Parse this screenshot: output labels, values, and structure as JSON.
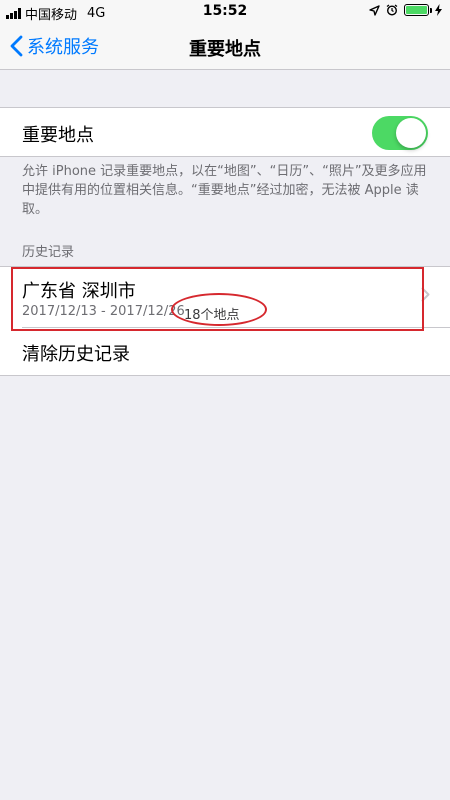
{
  "status_bar": {
    "carrier": "中国移动",
    "network": "4G",
    "time": "15:52",
    "battery_level": 1.0,
    "battery_color": "#4cd964"
  },
  "nav": {
    "back_label": "系统服务",
    "title": "重要地点",
    "back_icon": "chevron-left-icon"
  },
  "toggle_row": {
    "label": "重要地点",
    "enabled": true,
    "on_color": "#4cd964"
  },
  "footer": {
    "text": "允许 iPhone 记录重要地点，以在“地图”、“日历”、“照片”及更多应用中提供有用的位置相关信息。“重要地点”经过加密，无法被 Apple 读取。"
  },
  "history": {
    "header": "历史记录",
    "items": [
      {
        "title": "广东省 深圳市",
        "date_range": "2017/12/13 - 2017/12/26",
        "count": "18个地点"
      }
    ],
    "clear_label": "清除历史记录"
  },
  "colors": {
    "accent": "#007aff",
    "annotation": "#d6282e",
    "background": "#efeff4"
  }
}
